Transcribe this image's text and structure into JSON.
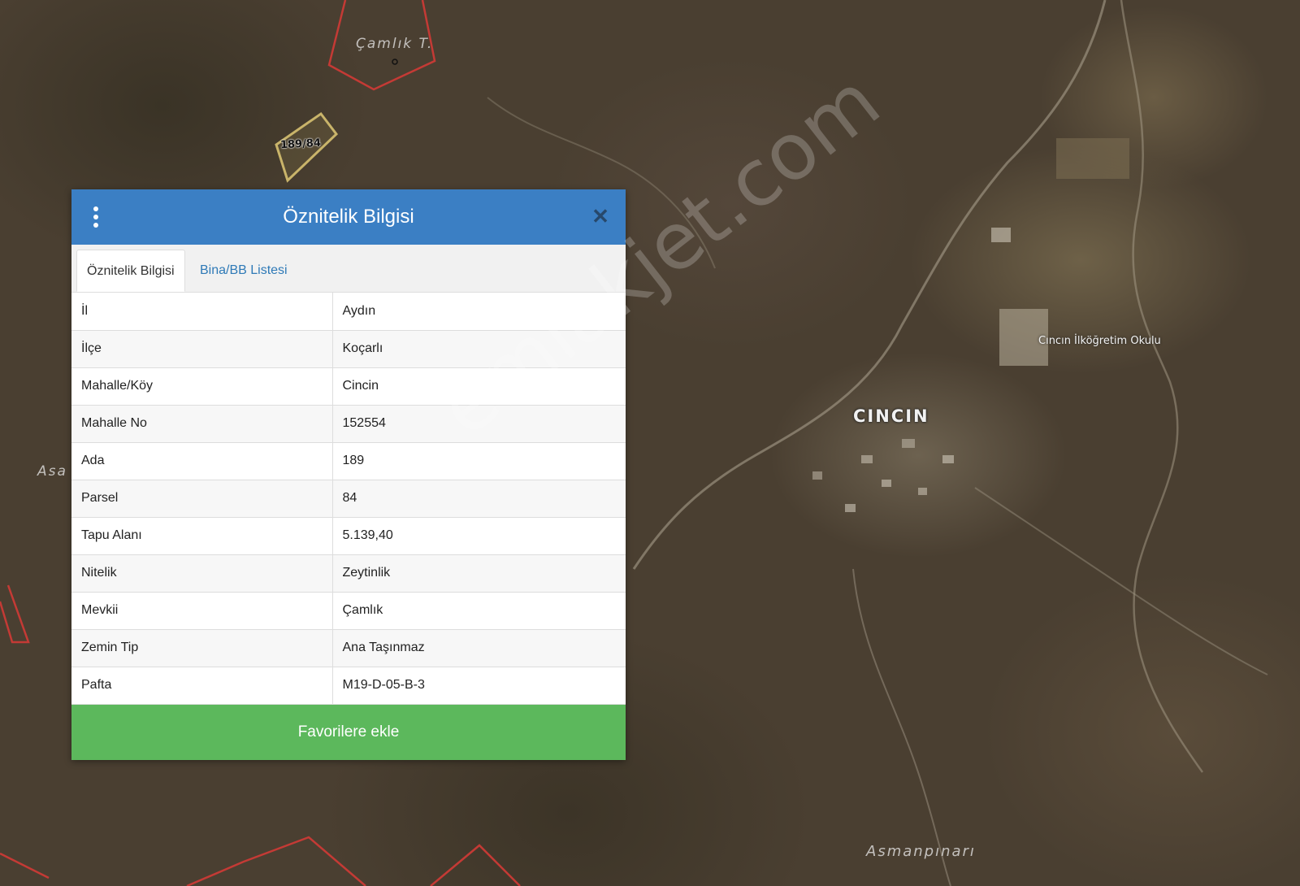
{
  "map": {
    "labels": {
      "camlik": "Çamlık T.",
      "asa": "Asa",
      "cincin": "CINCIN",
      "school": "Cıncın İlköğretim Okulu",
      "asmanpinari": "Asmanpınarı",
      "parcel": "189/84"
    },
    "watermark": "emlakjet.com",
    "colors": {
      "parcel_outline": "#c9b46a",
      "boundary": "#d23a3a"
    }
  },
  "popup": {
    "title": "Öznitelik Bilgisi",
    "menu_icon": "kebab-menu-icon",
    "close_icon": "close-icon",
    "tabs": [
      {
        "label": "Öznitelik Bilgisi",
        "active": true
      },
      {
        "label": "Bina/BB Listesi",
        "active": false
      }
    ],
    "rows": [
      {
        "key": "İl",
        "value": "Aydın"
      },
      {
        "key": "İlçe",
        "value": "Koçarlı"
      },
      {
        "key": "Mahalle/Köy",
        "value": "Cincin"
      },
      {
        "key": "Mahalle No",
        "value": "152554"
      },
      {
        "key": "Ada",
        "value": "189"
      },
      {
        "key": "Parsel",
        "value": "84"
      },
      {
        "key": "Tapu Alanı",
        "value": "5.139,40"
      },
      {
        "key": "Nitelik",
        "value": "Zeytinlik"
      },
      {
        "key": "Mevkii",
        "value": "Çamlık"
      },
      {
        "key": "Zemin Tip",
        "value": "Ana Taşınmaz"
      },
      {
        "key": "Pafta",
        "value": "M19-D-05-B-3"
      }
    ],
    "favorite_button": "Favorilere ekle",
    "colors": {
      "header": "#3b7fc4",
      "button": "#5cb85c",
      "tab_link": "#2f7ab7"
    }
  }
}
